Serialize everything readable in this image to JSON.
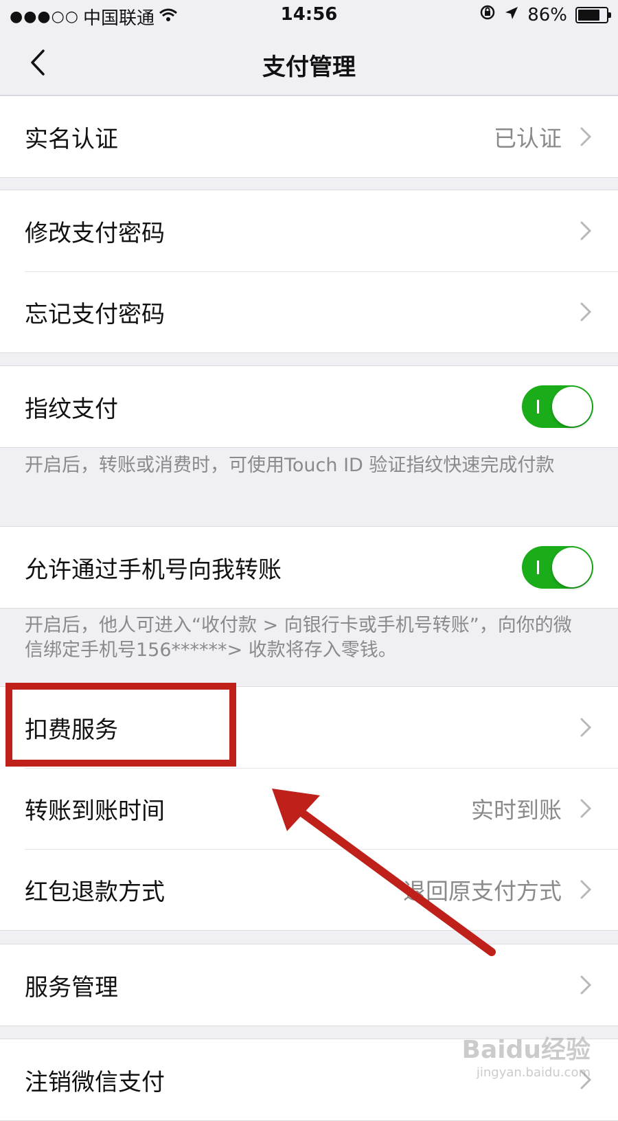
{
  "status_bar": {
    "signal_dots": "●●●○○",
    "carrier": "中国联通",
    "time": "14:56",
    "battery": "86%",
    "battery_level": 0.86
  },
  "nav": {
    "title": "支付管理"
  },
  "groups": {
    "verify": {
      "label": "实名认证",
      "value": "已认证"
    },
    "password": {
      "change_label": "修改支付密码",
      "forgot_label": "忘记支付密码"
    },
    "fingerprint": {
      "label": "指纹支付",
      "enabled": true,
      "footnote": "开启后，转账或消费时，可使用Touch ID 验证指纹快速完成付款"
    },
    "phone_transfer": {
      "label": "允许通过手机号向我转账",
      "enabled": true,
      "footnote": "开启后，他人可进入“收付款 > 向银行卡或手机号转账”，向你的微信绑定手机号156******> 收款将存入零钱。"
    },
    "services": {
      "deduction_label": "扣费服务",
      "arrival_label": "转账到账时间",
      "arrival_value": "实时到账",
      "refund_label": "红包退款方式",
      "refund_value": "退回原支付方式"
    },
    "service_mgmt": {
      "label": "服务管理"
    },
    "cancel": {
      "label": "注销微信支付"
    }
  },
  "watermark": {
    "brand": "Baidu经验",
    "url": "jingyan.baidu.com"
  },
  "colors": {
    "toggle_on": "#1aad19",
    "annotation": "#c0201a"
  }
}
